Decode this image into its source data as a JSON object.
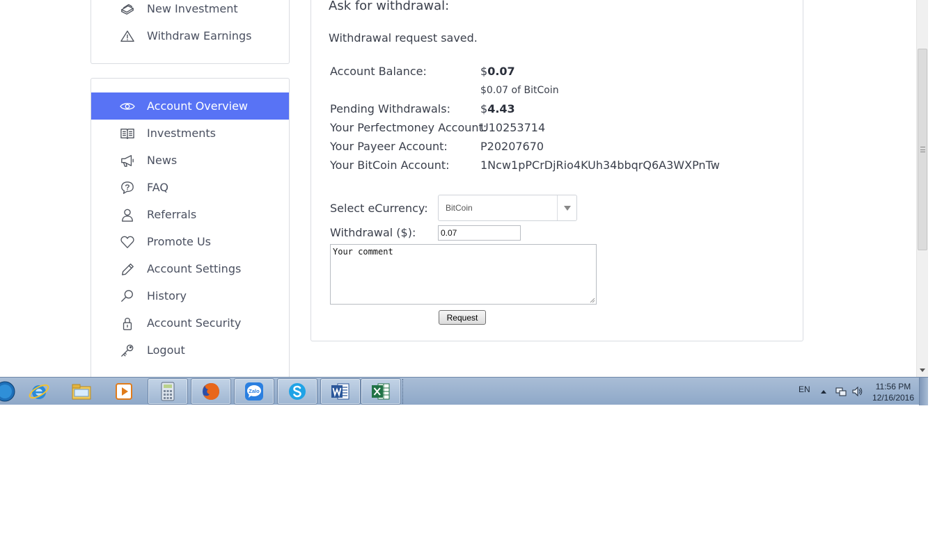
{
  "sidebar_top": {
    "items": [
      {
        "label": "New Investment",
        "icon": "money-stack-icon"
      },
      {
        "label": "Withdraw Earnings",
        "icon": "warning-icon"
      }
    ]
  },
  "sidebar": {
    "active_color": "#5873f5",
    "items": [
      {
        "label": "Account Overview",
        "icon": "eye-icon",
        "active": true
      },
      {
        "label": "Investments",
        "icon": "book-icon"
      },
      {
        "label": "News",
        "icon": "megaphone-icon"
      },
      {
        "label": "FAQ",
        "icon": "chat-question-icon"
      },
      {
        "label": "Referrals",
        "icon": "user-icon"
      },
      {
        "label": "Promote Us",
        "icon": "heart-icon"
      },
      {
        "label": "Account Settings",
        "icon": "pencil-icon"
      },
      {
        "label": "History",
        "icon": "magnifier-icon"
      },
      {
        "label": "Account Security",
        "icon": "lock-icon"
      },
      {
        "label": "Logout",
        "icon": "key-icon"
      }
    ]
  },
  "main": {
    "title": "Ask for withdrawal:",
    "status": "Withdrawal request saved.",
    "balance": {
      "label": "Account Balance:",
      "currency": "$",
      "value": "0.07",
      "sub": "$0.07 of BitCoin"
    },
    "pending": {
      "label": "Pending Withdrawals:",
      "currency": "$",
      "value": "4.43"
    },
    "perfectmoney": {
      "label": "Your Perfectmoney Account:",
      "value": "U10253714"
    },
    "payeer": {
      "label": "Your Payeer Account:",
      "value": "P20207670"
    },
    "bitcoin": {
      "label": "Your BitCoin Account:",
      "value": "1Ncw1pPCrDjRio4KUh34bbqrQ6A3WXPnTw"
    }
  },
  "form": {
    "currency_label": "Select eCurrency:",
    "currency_selected": "BitCoin",
    "amount_label": "Withdrawal ($):",
    "amount_value": "0.07",
    "comment_placeholder": "Your comment",
    "submit_label": "Request"
  },
  "taskbar": {
    "apps": [
      {
        "name": "start-button",
        "icon": "windows-orb-icon"
      },
      {
        "name": "internet-explorer",
        "icon": "ie-icon"
      },
      {
        "name": "file-explorer",
        "icon": "folder-icon"
      },
      {
        "name": "media-player",
        "icon": "media-player-icon"
      },
      {
        "name": "calculator",
        "icon": "calculator-icon"
      },
      {
        "name": "firefox",
        "icon": "firefox-icon"
      },
      {
        "name": "zalo",
        "icon": "zalo-icon",
        "label": "Zalo"
      },
      {
        "name": "skype",
        "icon": "skype-icon"
      },
      {
        "name": "word",
        "icon": "word-icon"
      },
      {
        "name": "excel",
        "icon": "excel-icon"
      }
    ],
    "language": "EN",
    "time": "11:56 PM",
    "date": "12/16/2016"
  }
}
